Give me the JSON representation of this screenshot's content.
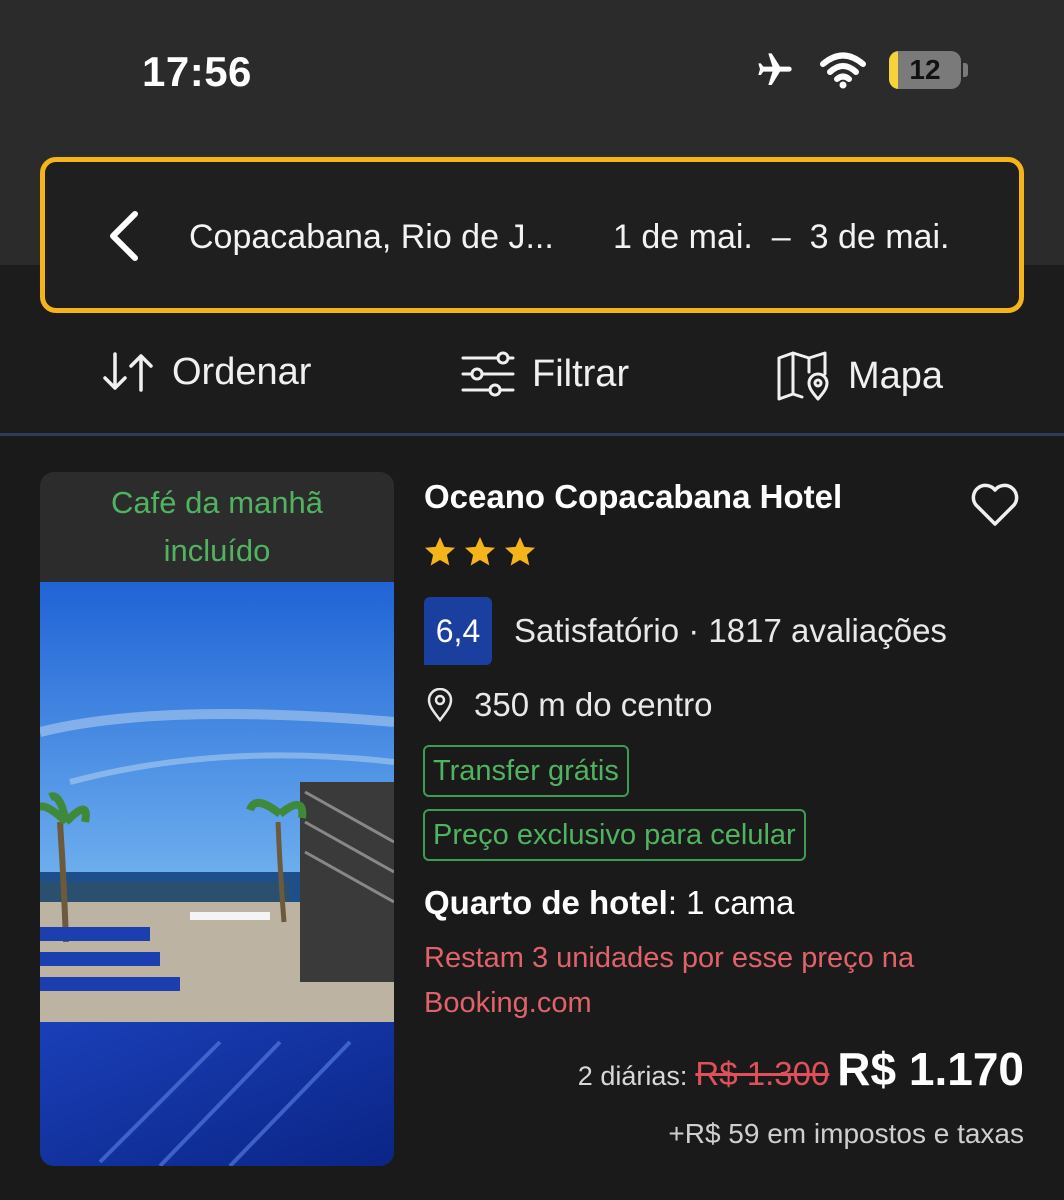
{
  "status_bar": {
    "time": "17:56",
    "battery": "12"
  },
  "search": {
    "destination": "Copacabana, Rio de J...",
    "date_from": "1 de mai.",
    "date_sep": "–",
    "date_to": "3 de mai."
  },
  "toolbar": {
    "sort_label": "Ordenar",
    "filter_label": "Filtrar",
    "map_label": "Mapa"
  },
  "hotel": {
    "photo_banner_line1": "Café da manhã",
    "photo_banner_line2": "incluído",
    "name": "Oceano Copacabana Hotel",
    "stars": 3,
    "score": "6,4",
    "rating_word": "Satisfatório",
    "reviews": "· 1817 avaliações",
    "distance": "350 m do centro",
    "tags": [
      "Transfer grátis",
      "Preço exclusivo para celular"
    ],
    "room_type": "Quarto de hotel",
    "room_detail": ": 1 cama",
    "availability_note": "Restam 3 unidades por esse preço na Booking.com",
    "nights": "2 diárias:",
    "old_price": "R$ 1.300",
    "price": "R$ 1.170",
    "taxes": "+R$ 59 em impostos e taxas"
  },
  "colors": {
    "accent_border": "#f4b41a",
    "star": "#f4b41a",
    "score_bg": "#1a3f9e",
    "tag_green": "#4fb35f",
    "warning_red": "#e0626a"
  }
}
